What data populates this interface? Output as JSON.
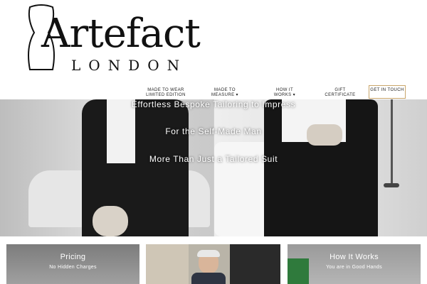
{
  "brand": {
    "name": "Artefact",
    "location": "LONDON",
    "logo_icon": "dress-form-icon"
  },
  "nav": {
    "items": [
      "MADE TO WEAR LIMITED EDITION",
      "MADE TO MEASURE ▾",
      "HOW IT WORKS ▾",
      "GIFT CERTIFICATE"
    ],
    "cta": "GET IN TOUCH"
  },
  "hero": {
    "lines": [
      "Effortless Bespoke Tailoring to Impress",
      "For the Self-Made Man",
      "More Than Just a Tailored Suit"
    ]
  },
  "cards": [
    {
      "title": "Pricing",
      "subtitle": "No Hidden Charges"
    },
    {
      "title": "",
      "subtitle": ""
    },
    {
      "title": "How It Works",
      "subtitle": "You are in Good Hands"
    }
  ],
  "colors": {
    "accent_border": "#c9a56a",
    "text": "#111111"
  }
}
